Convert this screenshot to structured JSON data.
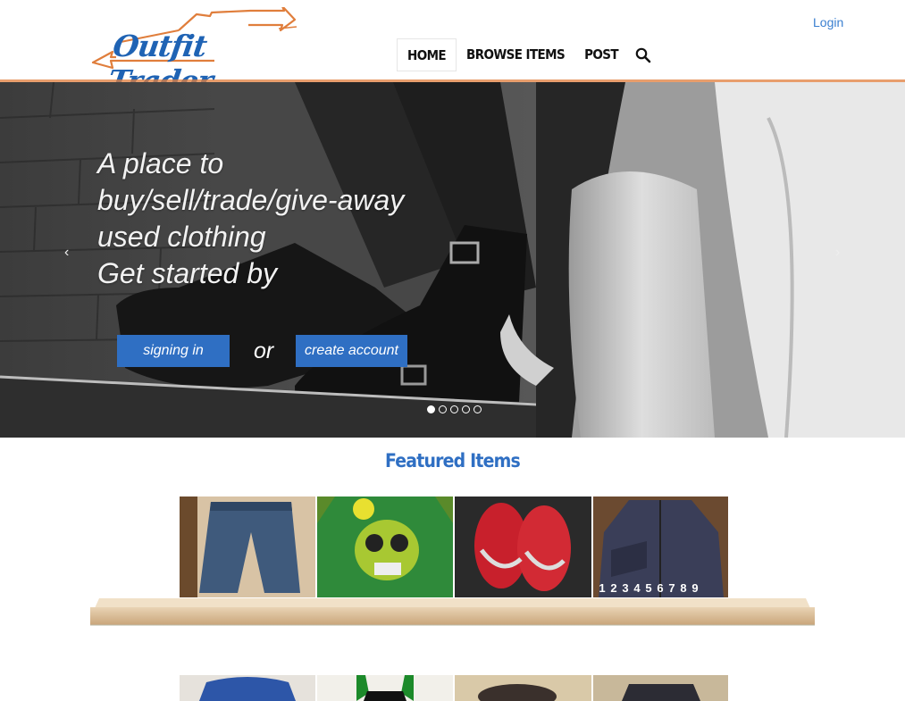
{
  "header": {
    "logo_text": "Outfit Trader",
    "login_label": "Login",
    "nav": [
      {
        "label": "HOME",
        "active": true
      },
      {
        "label": "BROWSE ITEMS",
        "active": false
      },
      {
        "label": "POST",
        "active": false
      }
    ],
    "search_icon": "search-icon",
    "accent_color": "#e07e3c",
    "brand_color": "#1f63b4"
  },
  "hero": {
    "caption_lines": [
      "A place to",
      "buy/sell/trade/give-away",
      "used clothing",
      "Get started by"
    ],
    "signin_label": "signing in",
    "or_label": "or",
    "create_label": "create account",
    "prev_arrow": "‹",
    "next_arrow": "›",
    "slide_count": 5,
    "active_slide": 1,
    "button_color": "#2f6fc3"
  },
  "featured": {
    "title": "Featured Items",
    "items": [
      {
        "name": "jeans"
      },
      {
        "name": "green skull t-shirt"
      },
      {
        "name": "red sneakers"
      },
      {
        "name": "dark jacket"
      }
    ],
    "pager": [
      "1",
      "2",
      "3",
      "4",
      "5",
      "6",
      "7",
      "8",
      "9"
    ],
    "second_row": [
      {
        "name": "blue top"
      },
      {
        "name": "black top on hanger"
      },
      {
        "name": "shoes"
      },
      {
        "name": "dark skirt"
      }
    ]
  }
}
